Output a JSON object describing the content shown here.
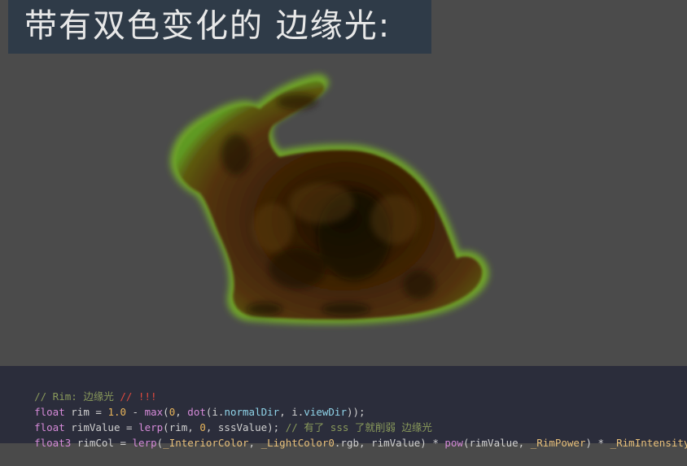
{
  "title": "带有双色变化的 边缘光:",
  "colors": {
    "background": "#4b4b4b",
    "title_bar": "#2f3b48",
    "code_bg": "#2b2d3b",
    "rim_green": "#6fa42a",
    "interior_brown": "#4a2a08"
  },
  "code": {
    "line1": {
      "comment": "// Rim: 边缘光",
      "comment_red": " // !!!"
    },
    "line2": {
      "kw": "float",
      "text1": " rim = ",
      "num1": "1.0",
      "text2": " - ",
      "fn1": "max",
      "text3": "(",
      "num2": "0",
      "text4": ", ",
      "fn2": "dot",
      "text5": "(i.",
      "prop1": "normalDir",
      "text6": ", i.",
      "prop2": "viewDir",
      "text7": "));"
    },
    "line3": {
      "kw": "float",
      "text1": " rimValue = ",
      "fn1": "lerp",
      "text2": "(rim, ",
      "num1": "0",
      "text3": ", sssValue); ",
      "comment": "// 有了 sss 了就削弱 边缘光"
    },
    "line4": {
      "kw": "float3",
      "text1": " rimCol = ",
      "fn1": "lerp",
      "text2": "(",
      "param1": "_InteriorColor",
      "text3": ", ",
      "param2": "_LightColor0",
      "text4": ".rgb, rimValue) * ",
      "fn2": "pow",
      "text5": "(rimValue, ",
      "param3": "_RimPower",
      "text6": ") * ",
      "param4": "_RimIntensity",
      "text7": ";"
    }
  }
}
